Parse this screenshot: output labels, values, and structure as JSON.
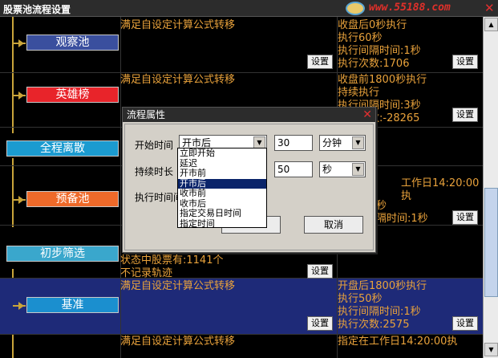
{
  "window": {
    "title": "股票池流程设置",
    "brand": "www.55188.com",
    "close": "✕"
  },
  "nodes": [
    {
      "label": "观察池",
      "color": "#3a4f9e"
    },
    {
      "label": "英雄榜",
      "color": "#e8242a"
    },
    {
      "label": "全程离散",
      "color": "#1b9bd0"
    },
    {
      "label": "预备池",
      "color": "#ee6a2a"
    },
    {
      "label": "初步筛选",
      "color": "#3aa7cc"
    },
    {
      "label": "基准",
      "color": "#1b8fcf"
    }
  ],
  "rows": [
    {
      "mid": [
        "满足自设定计算公式转移"
      ],
      "right": [
        "收盘后0秒执行",
        "执行60秒",
        "执行间隔时间:1秒",
        "执行次数:1706"
      ]
    },
    {
      "mid": [
        "满足自设定计算公式转移"
      ],
      "right": [
        "收盘前1800秒执行",
        "持续执行",
        "执行间隔时间:3秒",
        "执行次数:-28265"
      ]
    },
    {
      "mid": [],
      "right": [
        "工作日14:20:00执"
      ]
    },
    {
      "mid": [],
      "right": [
        "秒",
        "隔时间:1秒"
      ]
    },
    {
      "mid": [
        "状态中股票有:1141个",
        "不记录轨迹"
      ],
      "right": []
    },
    {
      "mid": [
        "满足自设定计算公式转移"
      ],
      "right": [
        "开盘后1800秒执行",
        "执行50秒",
        "执行间隔时间:1秒",
        "执行次数:2575"
      ]
    },
    {
      "mid": [
        "满足自设定计算公式转移"
      ],
      "right": [
        "指定在工作日14:20:00执"
      ]
    }
  ],
  "settings_label": "设置",
  "dialog": {
    "title": "流程属性",
    "start_label": "开始时间",
    "start_value": "开市后",
    "start_number": "30",
    "start_unit": "分钟",
    "duration_label": "持续时长",
    "duration_number": "50",
    "duration_unit": "秒",
    "interval_label": "执行时间间",
    "cancel": "取消",
    "options": [
      "立即开始",
      "延迟",
      "开市前",
      "开市后",
      "收市前",
      "收市后",
      "指定交易日时间",
      "指定时间"
    ],
    "selected_option": "开市后"
  },
  "scroll_up": "▲",
  "scroll_down": "▼",
  "dropdown_arrow": "▼"
}
